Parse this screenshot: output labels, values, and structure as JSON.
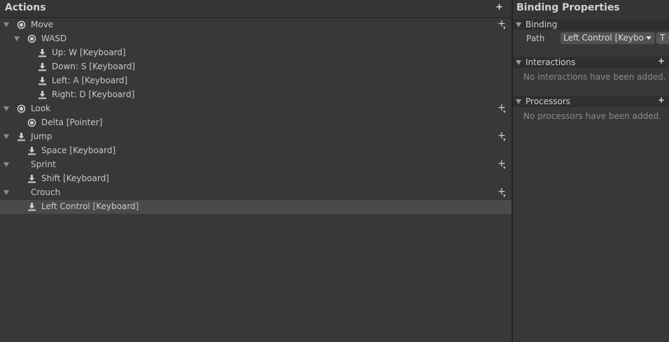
{
  "actions_panel": {
    "title": "Actions",
    "add_label": "+",
    "rows": [
      {
        "label": "Move",
        "expanded": true,
        "icon": "radio-icon",
        "has_add": true
      },
      {
        "label": "WASD",
        "expanded": true,
        "icon": "radio-icon",
        "has_add": false
      },
      {
        "label": "Up: W [Keyboard]",
        "icon": "binding-icon",
        "has_add": false
      },
      {
        "label": "Down: S [Keyboard]",
        "icon": "binding-icon",
        "has_add": false
      },
      {
        "label": "Left: A [Keyboard]",
        "icon": "binding-icon",
        "has_add": false
      },
      {
        "label": "Right: D [Keyboard]",
        "icon": "binding-icon",
        "has_add": false
      },
      {
        "label": "Look",
        "expanded": true,
        "icon": "radio-icon",
        "has_add": true
      },
      {
        "label": "Delta [Pointer]",
        "icon": "radio-icon",
        "has_add": false
      },
      {
        "label": "Jump",
        "expanded": true,
        "icon": "binding-icon",
        "has_add": true
      },
      {
        "label": "Space [Keyboard]",
        "icon": "binding-icon",
        "has_add": false
      },
      {
        "label": "Sprint",
        "expanded": true,
        "icon": "none",
        "has_add": true
      },
      {
        "label": "Shift [Keyboard]",
        "icon": "binding-icon",
        "has_add": false
      },
      {
        "label": "Crouch",
        "expanded": true,
        "icon": "none",
        "has_add": true
      },
      {
        "label": "Left Control [Keyboard]",
        "icon": "binding-icon",
        "has_add": false,
        "selected": true
      }
    ]
  },
  "properties_panel": {
    "title": "Binding Properties",
    "binding_section": {
      "title": "Binding",
      "path_label": "Path",
      "path_value": "Left Control [Keyboa",
      "t_button": "T"
    },
    "interactions_section": {
      "title": "Interactions",
      "add_label": "+",
      "empty_text": "No interactions have been added."
    },
    "processors_section": {
      "title": "Processors",
      "add_label": "+",
      "empty_text": "No processors have been added."
    }
  },
  "colors": {
    "background": "#383838",
    "header": "#353535",
    "selected_row": "#4a4a4a",
    "divider": "#232323"
  }
}
